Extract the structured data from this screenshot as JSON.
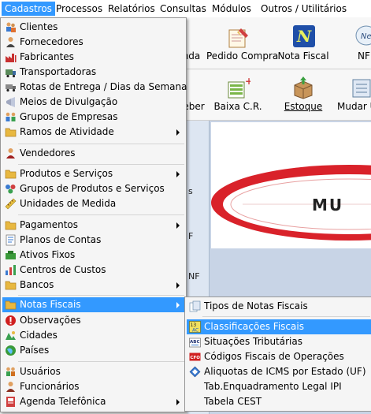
{
  "menubar": {
    "items": [
      "Cadastros",
      "Processos",
      "Relatórios",
      "Consultas",
      "Módulos",
      "Outros / Utilitários"
    ],
    "active": "Cadastros"
  },
  "toolbar1": {
    "partial_left": "nda",
    "buttons": [
      "Pedido Compra",
      "Nota Fiscal",
      "NF"
    ]
  },
  "toolbar2": {
    "partial_left": "eber",
    "buttons": [
      "Baixa C.R.",
      "Estoque",
      "Mudar U"
    ]
  },
  "left_panel_fragments": [
    "s",
    "F",
    "NF"
  ],
  "logo_fragment": "MU",
  "cadastros_menu": [
    {
      "label": "Clientes",
      "icon": "clients-icon"
    },
    {
      "label": "Fornecedores",
      "icon": "suppliers-icon"
    },
    {
      "label": "Fabricantes",
      "icon": "factory-icon"
    },
    {
      "label": "Transportadoras",
      "icon": "truck-icon"
    },
    {
      "label": "Rotas de Entrega / Dias da Semana",
      "icon": "route-icon"
    },
    {
      "label": "Meios de Divulgação",
      "icon": "megaphone-icon"
    },
    {
      "label": "Grupos de Empresas",
      "icon": "company-group-icon"
    },
    {
      "label": "Ramos de Atividade",
      "icon": "folder-icon",
      "submenu": true
    },
    {
      "separator": true
    },
    {
      "label": "Vendedores",
      "icon": "salesperson-icon"
    },
    {
      "separator": true
    },
    {
      "label": "Produtos e Serviços",
      "icon": "folder-icon",
      "submenu": true
    },
    {
      "label": "Grupos de Produtos e Serviços",
      "icon": "product-groups-icon"
    },
    {
      "label": "Unidades de Medida",
      "icon": "ruler-icon"
    },
    {
      "separator": true
    },
    {
      "label": "Pagamentos",
      "icon": "folder-icon",
      "submenu": true
    },
    {
      "label": "Planos de Contas",
      "icon": "chart-accounts-icon"
    },
    {
      "label": "Ativos Fixos",
      "icon": "fixed-assets-icon"
    },
    {
      "label": "Centros de Custos",
      "icon": "cost-center-icon"
    },
    {
      "label": "Bancos",
      "icon": "folder-icon",
      "submenu": true
    },
    {
      "separator": true
    },
    {
      "label": "Notas Fiscais",
      "icon": "folder-icon",
      "submenu": true,
      "highlighted": true
    },
    {
      "label": "Observações",
      "icon": "warning-icon"
    },
    {
      "label": "Cidades",
      "icon": "cities-icon"
    },
    {
      "label": "Países",
      "icon": "globe-icon"
    },
    {
      "separator": true
    },
    {
      "label": "Usuários",
      "icon": "users-icon"
    },
    {
      "label": "Funcionários",
      "icon": "employee-icon"
    },
    {
      "label": "Agenda Telefônica",
      "icon": "phonebook-icon",
      "submenu": true
    }
  ],
  "notas_fiscais_submenu": [
    {
      "label": "Tipos de Notas Fiscais",
      "icon": "invoice-types-icon"
    },
    {
      "separator": true
    },
    {
      "label": "Classificações Fiscais",
      "icon": "classification-icon",
      "highlighted": true
    },
    {
      "label": "Situações Tributárias",
      "icon": "abc-tax-icon"
    },
    {
      "label": "Códigos Fiscais de Operações",
      "icon": "cfo-icon"
    },
    {
      "label": "Aliquotas de ICMS por Estado (UF)",
      "icon": "icms-rate-icon"
    },
    {
      "label": "Tab.Enquadramento Legal IPI",
      "icon": "none"
    },
    {
      "label": "Tabela CEST",
      "icon": "none"
    }
  ],
  "colors": {
    "highlight": "#3399ff",
    "menu_bg": "#f5f5f5",
    "logo_red": "#d9222a"
  }
}
